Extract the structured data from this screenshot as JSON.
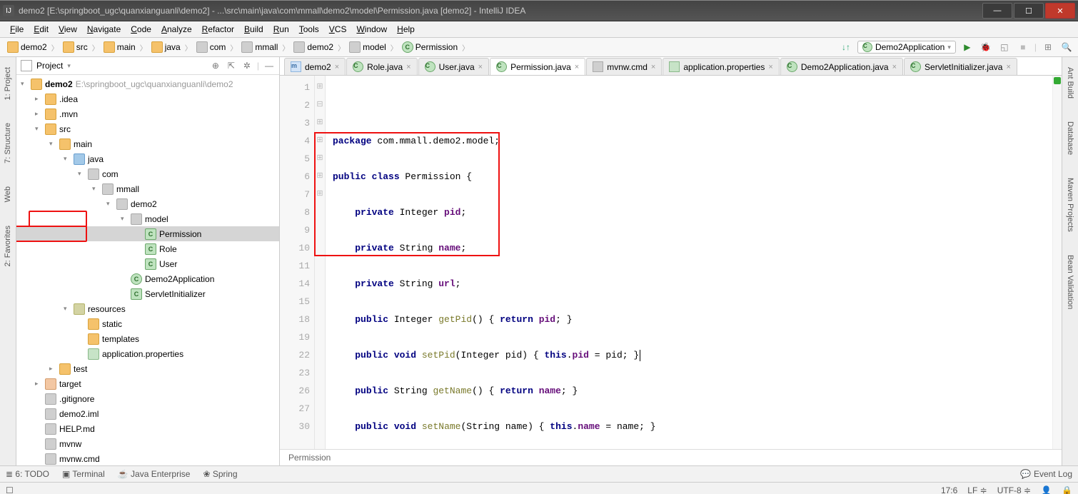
{
  "window": {
    "title": "demo2 [E:\\springboot_ugc\\quanxianguanli\\demo2] - ...\\src\\main\\java\\com\\mmall\\demo2\\model\\Permission.java [demo2] - IntelliJ IDEA"
  },
  "menu": [
    "File",
    "Edit",
    "View",
    "Navigate",
    "Code",
    "Analyze",
    "Refactor",
    "Build",
    "Run",
    "Tools",
    "VCS",
    "Window",
    "Help"
  ],
  "breadcrumbs": [
    "demo2",
    "src",
    "main",
    "java",
    "com",
    "mmall",
    "demo2",
    "model",
    "Permission"
  ],
  "run_config": "Demo2Application",
  "project_panel": {
    "title": "Project"
  },
  "tree": {
    "root": {
      "name": "demo2",
      "path": "E:\\springboot_ugc\\quanxianguanli\\demo2"
    },
    "nodes": [
      {
        "d": 1,
        "arr": ">",
        "ic": "folder",
        "label": ".idea"
      },
      {
        "d": 1,
        "arr": ">",
        "ic": "folder",
        "label": ".mvn"
      },
      {
        "d": 1,
        "arr": "v",
        "ic": "folder",
        "label": "src"
      },
      {
        "d": 2,
        "arr": "v",
        "ic": "folder",
        "label": "main"
      },
      {
        "d": 3,
        "arr": "v",
        "ic": "folder-src",
        "label": "java"
      },
      {
        "d": 4,
        "arr": "v",
        "ic": "pkg",
        "label": "com"
      },
      {
        "d": 5,
        "arr": "v",
        "ic": "pkg",
        "label": "mmall"
      },
      {
        "d": 6,
        "arr": "v",
        "ic": "pkg",
        "label": "demo2"
      },
      {
        "d": 7,
        "arr": "v",
        "ic": "pkg",
        "label": "model",
        "boxmodel": true
      },
      {
        "d": 8,
        "arr": "",
        "ic": "cls",
        "label": "Permission",
        "sel": true,
        "box": true
      },
      {
        "d": 8,
        "arr": "",
        "ic": "cls",
        "label": "Role"
      },
      {
        "d": 8,
        "arr": "",
        "ic": "cls",
        "label": "User"
      },
      {
        "d": 7,
        "arr": "",
        "ic": "cls-run",
        "label": "Demo2Application"
      },
      {
        "d": 7,
        "arr": "",
        "ic": "cls",
        "label": "ServletInitializer"
      },
      {
        "d": 3,
        "arr": "v",
        "ic": "folder-res",
        "label": "resources"
      },
      {
        "d": 4,
        "arr": "",
        "ic": "folder",
        "label": "static"
      },
      {
        "d": 4,
        "arr": "",
        "ic": "folder",
        "label": "templates"
      },
      {
        "d": 4,
        "arr": "",
        "ic": "props",
        "label": "application.properties"
      },
      {
        "d": 2,
        "arr": ">",
        "ic": "folder",
        "label": "test"
      },
      {
        "d": 1,
        "arr": ">",
        "ic": "folder-exc",
        "label": "target"
      },
      {
        "d": 1,
        "arr": "",
        "ic": "file",
        "label": ".gitignore"
      },
      {
        "d": 1,
        "arr": "",
        "ic": "file",
        "label": "demo2.iml"
      },
      {
        "d": 1,
        "arr": "",
        "ic": "md",
        "label": "HELP.md"
      },
      {
        "d": 1,
        "arr": "",
        "ic": "file",
        "label": "mvnw"
      },
      {
        "d": 1,
        "arr": "",
        "ic": "file",
        "label": "mvnw.cmd"
      }
    ]
  },
  "tabs": [
    {
      "ic": "maven",
      "label": "demo2"
    },
    {
      "ic": "cls",
      "label": "Role.java"
    },
    {
      "ic": "cls",
      "label": "User.java"
    },
    {
      "ic": "cls",
      "label": "Permission.java",
      "active": true
    },
    {
      "ic": "file",
      "label": "mvnw.cmd"
    },
    {
      "ic": "props",
      "label": "application.properties"
    },
    {
      "ic": "cls",
      "label": "Demo2Application.java"
    },
    {
      "ic": "cls",
      "label": "ServletInitializer.java"
    }
  ],
  "code": {
    "lines": [
      1,
      2,
      3,
      4,
      5,
      6,
      7,
      8,
      9,
      10,
      11,
      14,
      15,
      18,
      19,
      22,
      23,
      26,
      27,
      30
    ],
    "breadcrumb": "Permission"
  },
  "left_tabs": [
    "1: Project",
    "7: Structure",
    "Web",
    "2: Favorites"
  ],
  "right_tabs": [
    "Ant Build",
    "Database",
    "Maven Projects",
    "Bean Validation"
  ],
  "bottom": [
    "6: TODO",
    "Terminal",
    "Java Enterprise",
    "Spring"
  ],
  "event_log": "Event Log",
  "status": {
    "pos": "17:6",
    "sep": "LF",
    "enc": "UTF-8"
  }
}
